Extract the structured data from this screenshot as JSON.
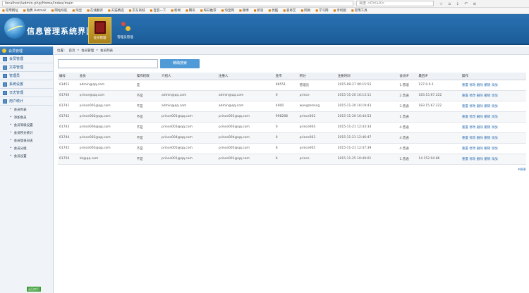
{
  "browser": {
    "url": "localhost/admin.php/Home/Index/main",
    "search_placeholder": "百度 <Ctrl+K>",
    "bookmarks": [
      "常用网址",
      "免费 Hotmail",
      "网站导航",
      "淘宝",
      "在线翻译",
      "天猫精选",
      "京东商城",
      "百度一下",
      "新闻",
      "腾讯",
      "每日推荐",
      "淘宝网",
      "微博",
      "新浪",
      "优酷",
      "爱奇艺",
      "网易",
      "学习网",
      "手机版",
      "常用工具"
    ]
  },
  "app": {
    "title": "信息管理系统界面",
    "tabs": [
      "会员管理",
      "管理员管理"
    ]
  },
  "sidebar": {
    "top_label": "会员管理",
    "items": [
      "会员管理",
      "文章管理",
      "管理员",
      "系统设置",
      "日志管理",
      "用户统计"
    ],
    "subitems": [
      "会员列表",
      "添加会员",
      "会员等级设置",
      "会员积分统计",
      "会员登录日志",
      "会员分组",
      "会员设置"
    ],
    "footer": "返回首页"
  },
  "breadcrumb": [
    "位置：",
    "首页",
    "会员管理",
    "会员列表"
  ],
  "search": {
    "placeholder": "",
    "button": "精确搜索"
  },
  "table": {
    "headers": [
      "编号",
      "会员",
      "操作权限",
      "介绍人",
      "注册人",
      "金币",
      "积分",
      "注册时间",
      "会员IP",
      "最后IP",
      "操作"
    ],
    "rows": [
      [
        "61451",
        "admin@qq.com",
        "是",
        "",
        "",
        "98551",
        "管理员",
        "2015-09-27 00:15:55",
        "1.管理",
        "127.0.0.1",
        "重置 修改 删除 撤销 添加"
      ],
      [
        "61740",
        "prince@qq.com",
        "不是",
        "admin@qq.com",
        "admin@qq.com",
        "0",
        "prince",
        "2015-11-20 16:13:11",
        "2.普通",
        "183.15.67.222",
        "重置 修改 删除 撤销 添加"
      ],
      [
        "61741",
        "prince001@qq.com",
        "不是",
        "admin@qq.com",
        "admin@qq.com",
        "4900",
        "wangzeming",
        "2015-11-20 16:19:43",
        "3.普通",
        "183.15.67.222",
        "重置 修改 删除 撤销 添加"
      ],
      [
        "61742",
        "prince002@qq.com",
        "不是",
        "prince001@qq.com",
        "prince001@qq.com",
        "998288",
        "prince002",
        "2015-11-20 16:44:53",
        "1.普通",
        "",
        "重置 修改 删除 撤销 添加"
      ],
      [
        "61743",
        "prince004@qq.com",
        "不是",
        "prince003@qq.com",
        "prince003@qq.com",
        "0",
        "prince004",
        "2015-11-21 12:43:33",
        "4.普通",
        "",
        "重置 修改 删除 撤销 添加"
      ],
      [
        "61744",
        "prince003@qq.com",
        "不是",
        "prince004@qq.com",
        "prince004@qq.com",
        "0",
        "prince003",
        "2015-11-21 12:46:47",
        "4.普通",
        "",
        "重置 修改 删除 撤销 添加"
      ],
      [
        "61745",
        "prince005@qq.com",
        "不是",
        "prince005@qq.com",
        "prince005@qq.com",
        "6",
        "prince005",
        "2015-11-21 12:47:39",
        "4.普通",
        "",
        "重置 修改 删除 撤销 添加"
      ],
      [
        "61750",
        "kk@qq.com",
        "不是",
        "prince001@qq.com",
        "prince001@qq.com",
        "6",
        "prince",
        "2015-11-25 10:49:01",
        "1.普通",
        "14.152.94.86",
        "重置 修改 删除 撤销 添加"
      ]
    ]
  },
  "pager": "共8条"
}
